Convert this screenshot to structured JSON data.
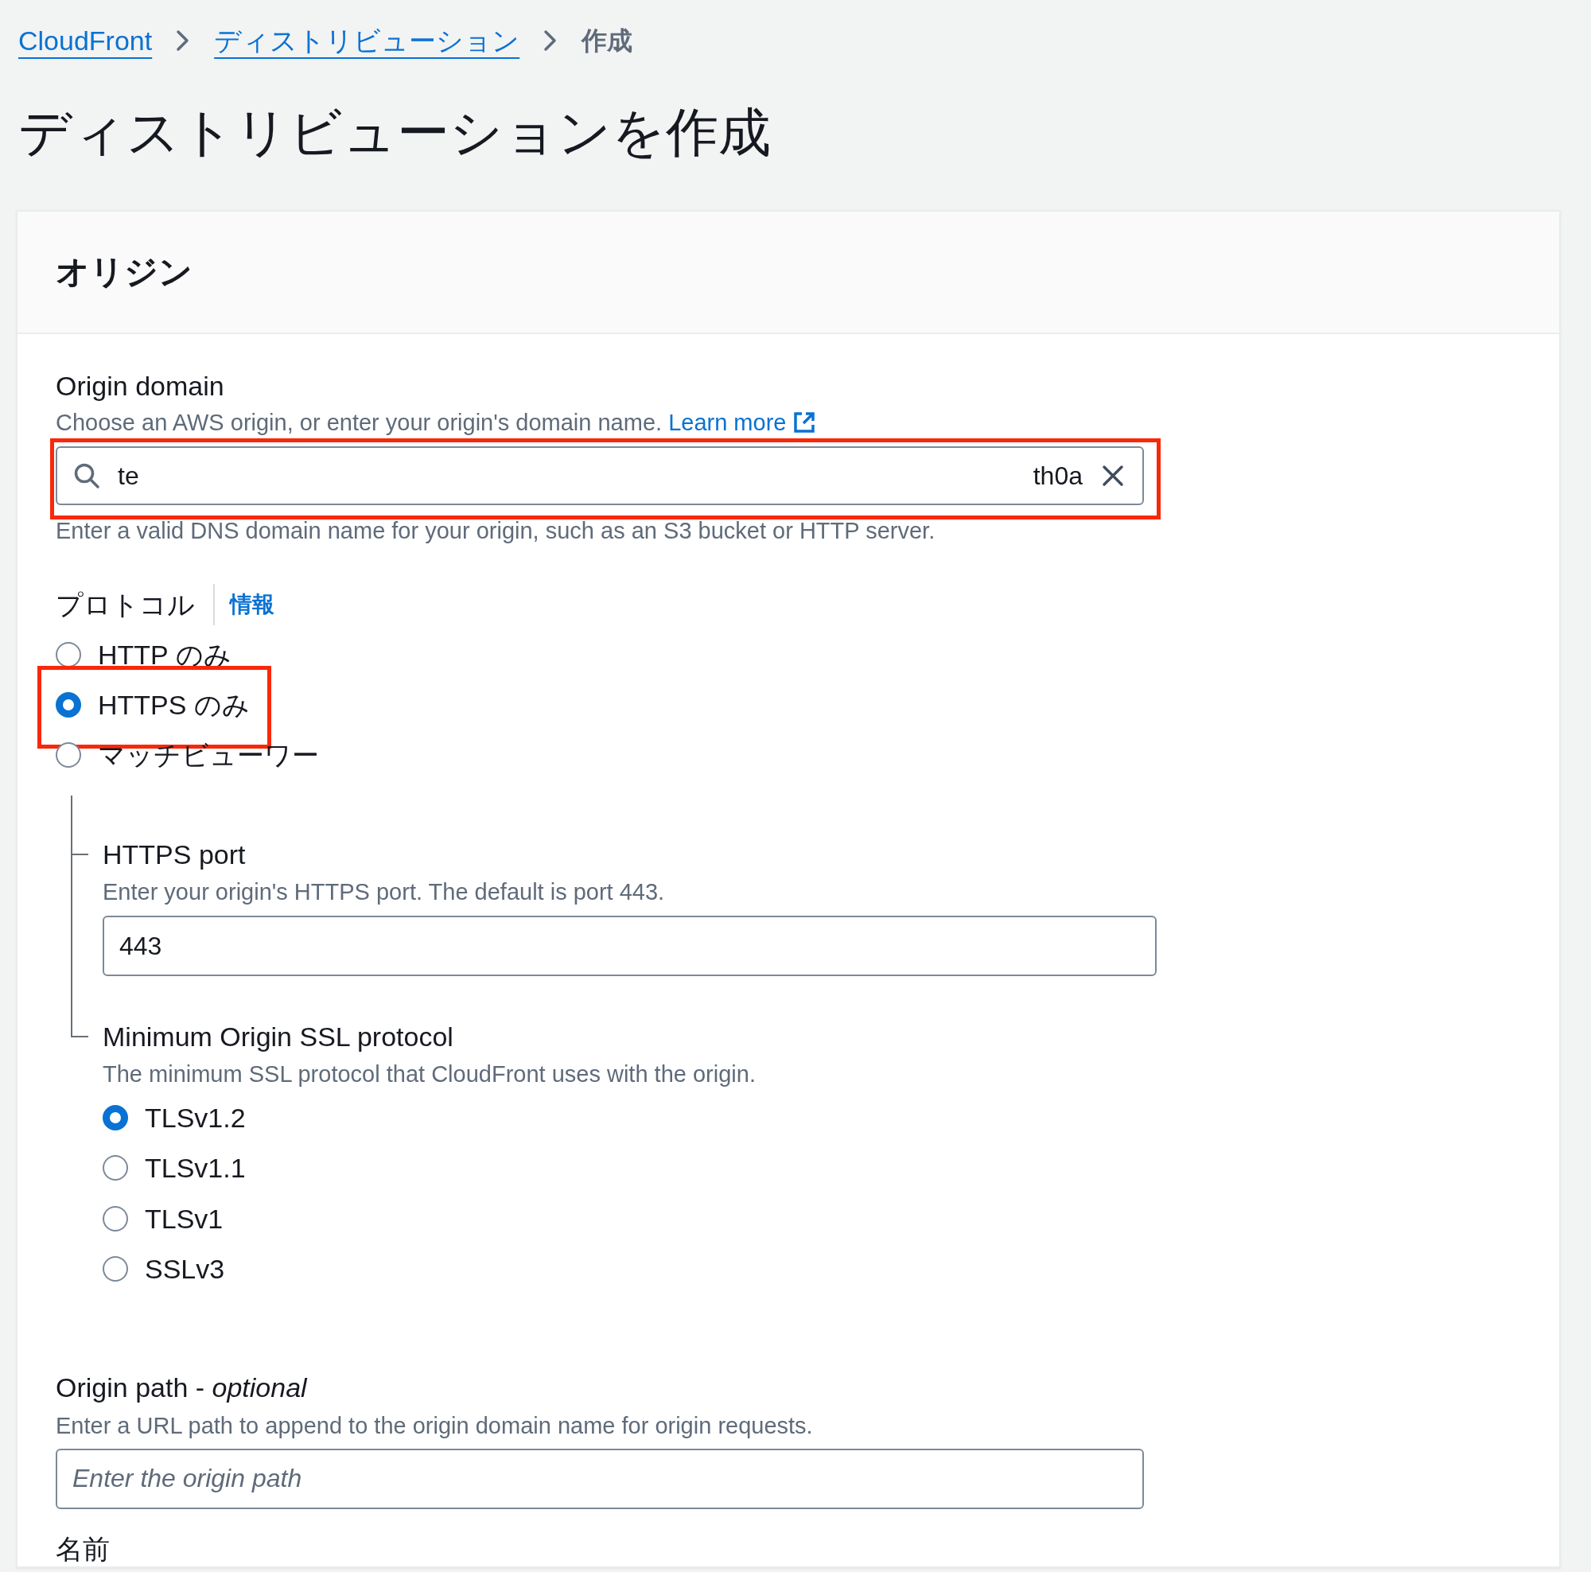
{
  "breadcrumbs": [
    {
      "label": "CloudFront",
      "kind": "link"
    },
    {
      "label": "ディストリビューション",
      "kind": "link"
    },
    {
      "label": "作成",
      "kind": "current"
    }
  ],
  "page_title": "ディストリビューションを作成",
  "section": {
    "title": "オリジン"
  },
  "origin_domain": {
    "label": "Origin domain",
    "description": "Choose an AWS origin, or enter your origin's domain name.",
    "link": "Learn more",
    "value_start": "te",
    "value_end": "th0a",
    "hint": "Enter a valid DNS domain name for your origin, such as an S3 bucket or HTTP server.",
    "highlighted": true
  },
  "protocol": {
    "label": "プロトコル",
    "info": "情報",
    "options": [
      {
        "label": "HTTP のみ",
        "selected": false,
        "highlighted": false
      },
      {
        "label": "HTTPS のみ",
        "selected": true,
        "highlighted": true
      },
      {
        "label": "マッチビューワー",
        "selected": false,
        "highlighted": false
      }
    ]
  },
  "https_port": {
    "label": "HTTPS port",
    "description": "Enter your origin's HTTPS port. The default is port 443.",
    "value": "443"
  },
  "min_ssl": {
    "label": "Minimum Origin SSL protocol",
    "description": "The minimum SSL protocol that CloudFront uses with the origin.",
    "options": [
      {
        "label": "TLSv1.2",
        "selected": true
      },
      {
        "label": "TLSv1.1",
        "selected": false
      },
      {
        "label": "TLSv1",
        "selected": false
      },
      {
        "label": "SSLv3",
        "selected": false
      }
    ]
  },
  "origin_path": {
    "label": "Origin path - *optional*",
    "description": "Enter a URL path to append to the origin domain name for origin requests.",
    "placeholder": "Enter the origin path"
  },
  "name_field": {
    "label": "名前"
  }
}
